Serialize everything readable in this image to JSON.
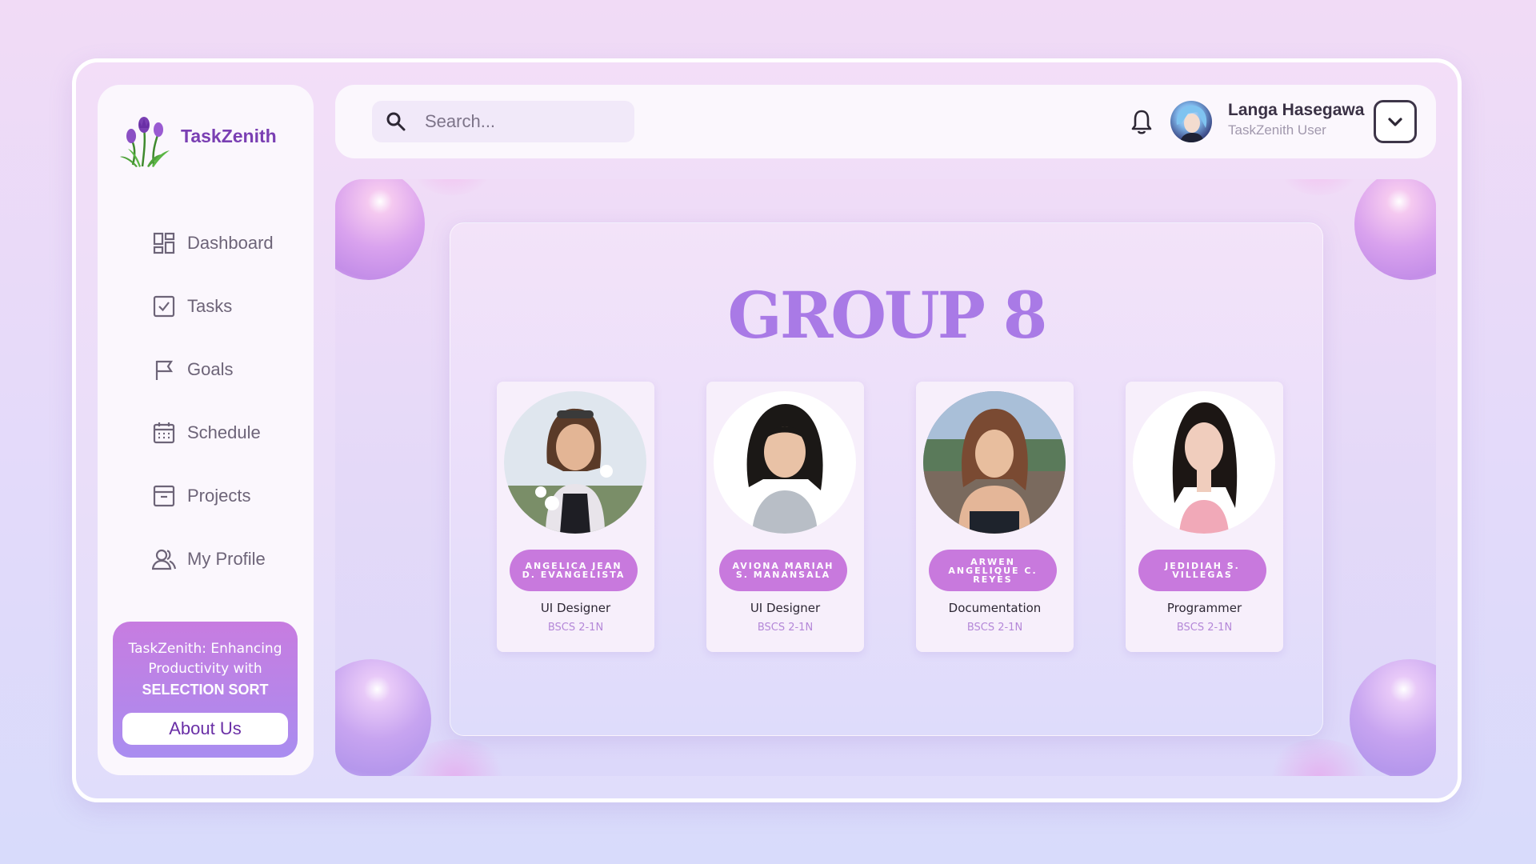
{
  "app": {
    "name": "TaskZenith"
  },
  "sidebar": {
    "items": [
      {
        "label": "Dashboard",
        "icon": "dashboard-icon"
      },
      {
        "label": "Tasks",
        "icon": "checkbox-icon"
      },
      {
        "label": "Goals",
        "icon": "flag-icon"
      },
      {
        "label": "Schedule",
        "icon": "calendar-icon"
      },
      {
        "label": "Projects",
        "icon": "archive-icon"
      },
      {
        "label": "My Profile",
        "icon": "users-icon"
      }
    ],
    "promo": {
      "line1": "TaskZenith: Enhancing",
      "line2": "Productivity with",
      "strong": "SELECTION SORT",
      "button": "About Us"
    }
  },
  "header": {
    "search_placeholder": "Search...",
    "user_name": "Langa Hasegawa",
    "user_role": "TaskZenith User"
  },
  "main": {
    "title": "GROUP 8",
    "members": [
      {
        "name": "ANGELICA JEAN D. EVANGELISTA",
        "role": "UI Designer",
        "section": "BSCS 2-1N"
      },
      {
        "name": "AVIONA MARIAH S. MANANSALA",
        "role": "UI Designer",
        "section": "BSCS 2-1N"
      },
      {
        "name": "ARWEN ANGELIQUE C. REYES",
        "role": "Documentation",
        "section": "BSCS 2-1N"
      },
      {
        "name": "JEDIDIAH S. VILLEGAS",
        "role": "Programmer",
        "section": "BSCS 2-1N"
      }
    ]
  },
  "colors": {
    "accent": "#7a3fb3",
    "title": "#a97ae6",
    "pill": "#c879dd"
  }
}
